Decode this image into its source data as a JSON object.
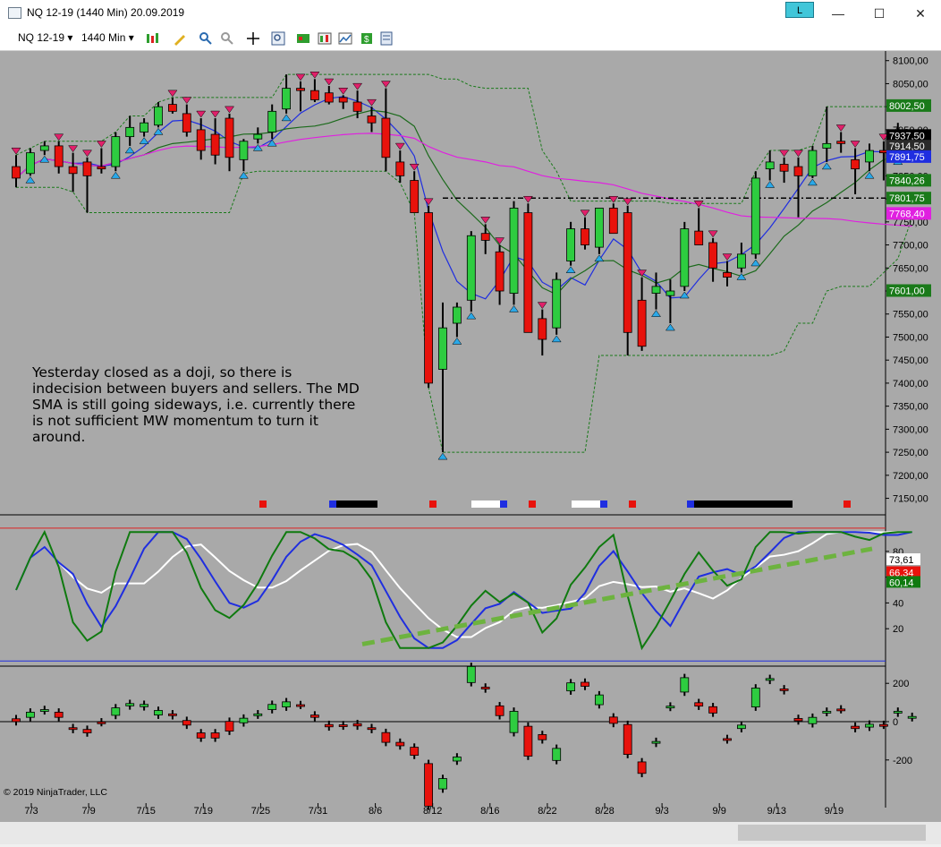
{
  "window": {
    "title": "NQ 12-19 (1440 Min)  20.09.2019",
    "badge": "L",
    "minimize": "—",
    "maximize": "☐",
    "close": "✕"
  },
  "toolbar": {
    "instrument": "NQ 12-19",
    "interval": "1440 Min"
  },
  "annotation": "Yesterday closed as a doji, so there is indecision between buyers and sellers. The MD SMA is still going sideways, i.e. currently there is not sufficient MW momentum to turn it around.",
  "copyright": "© 2019 NinjaTrader, LLC",
  "colors": {
    "background": "#a9a9a9",
    "bull": "#2ecc40",
    "bear": "#e8120c",
    "neutral_dark": "#8b1a1a",
    "upper_band": "#1a7a1a",
    "sma_blue": "#1f2ee0",
    "sma_magenta": "#e020e0",
    "rsi_green": "#0f7a0f",
    "rsi_white": "#ffffff"
  },
  "chart_data": [
    {
      "type": "candlestick",
      "panel": "price",
      "x_ticks": [
        "7/3",
        "7/9",
        "7/15",
        "7/19",
        "7/25",
        "7/31",
        "8/6",
        "8/12",
        "8/16",
        "8/22",
        "8/28",
        "9/3",
        "9/9",
        "9/13",
        "9/19"
      ],
      "y_ticks": [
        "8100,00",
        "8050,00",
        "8000,00",
        "7950,00",
        "7900,00",
        "7850,00",
        "7800,00",
        "7750,00",
        "7700,00",
        "7650,00",
        "7600,00",
        "7550,00",
        "7500,00",
        "7450,00",
        "7400,00",
        "7350,00",
        "7300,00",
        "7250,00",
        "7200,00",
        "7150,00"
      ],
      "ylim": [
        7120,
        8115
      ],
      "price_labels": [
        {
          "value": "8002,50",
          "color": "#1a7a1a"
        },
        {
          "value": "7937,50",
          "color": "#000000"
        },
        {
          "value": "7914,50",
          "color": "#2a2a2a"
        },
        {
          "value": "7891,75",
          "color": "#1f2ee0"
        },
        {
          "value": "7840,26",
          "color": "#1a7a1a"
        },
        {
          "value": "7801,75",
          "color": "#1a7a1a"
        },
        {
          "value": "7768,40",
          "color": "#e020e0"
        },
        {
          "value": "7601,00",
          "color": "#1a7a1a"
        }
      ],
      "candles": [
        {
          "o": 7870,
          "h": 7895,
          "l": 7825,
          "c": 7845
        },
        {
          "o": 7855,
          "h": 7910,
          "l": 7850,
          "c": 7900
        },
        {
          "o": 7905,
          "h": 7925,
          "l": 7895,
          "c": 7915
        },
        {
          "o": 7915,
          "h": 7925,
          "l": 7855,
          "c": 7870
        },
        {
          "o": 7870,
          "h": 7900,
          "l": 7815,
          "c": 7855
        },
        {
          "o": 7880,
          "h": 7890,
          "l": 7770,
          "c": 7850
        },
        {
          "o": 7870,
          "h": 7910,
          "l": 7855,
          "c": 7865
        },
        {
          "o": 7870,
          "h": 7945,
          "l": 7860,
          "c": 7935
        },
        {
          "o": 7935,
          "h": 7980,
          "l": 7915,
          "c": 7955
        },
        {
          "o": 7945,
          "h": 7975,
          "l": 7935,
          "c": 7965
        },
        {
          "o": 7960,
          "h": 8010,
          "l": 7955,
          "c": 8000
        },
        {
          "o": 8005,
          "h": 8020,
          "l": 7985,
          "c": 7990
        },
        {
          "o": 7985,
          "h": 8005,
          "l": 7935,
          "c": 7945
        },
        {
          "o": 7950,
          "h": 7975,
          "l": 7885,
          "c": 7905
        },
        {
          "o": 7940,
          "h": 7975,
          "l": 7875,
          "c": 7895
        },
        {
          "o": 7975,
          "h": 7985,
          "l": 7860,
          "c": 7890
        },
        {
          "o": 7885,
          "h": 7930,
          "l": 7860,
          "c": 7925
        },
        {
          "o": 7930,
          "h": 7955,
          "l": 7920,
          "c": 7940
        },
        {
          "o": 7945,
          "h": 8005,
          "l": 7930,
          "c": 7990
        },
        {
          "o": 7995,
          "h": 8070,
          "l": 7985,
          "c": 8040
        },
        {
          "o": 8040,
          "h": 8055,
          "l": 7990,
          "c": 8035
        },
        {
          "o": 8035,
          "h": 8060,
          "l": 8010,
          "c": 8015
        },
        {
          "o": 8030,
          "h": 8045,
          "l": 8005,
          "c": 8010
        },
        {
          "o": 8020,
          "h": 8025,
          "l": 7995,
          "c": 8010
        },
        {
          "o": 8010,
          "h": 8035,
          "l": 7975,
          "c": 7990
        },
        {
          "o": 7980,
          "h": 8000,
          "l": 7945,
          "c": 7965
        },
        {
          "o": 7975,
          "h": 8040,
          "l": 7860,
          "c": 7890
        },
        {
          "o": 7880,
          "h": 7905,
          "l": 7835,
          "c": 7850
        },
        {
          "o": 7840,
          "h": 7860,
          "l": 7770,
          "c": 7770
        },
        {
          "o": 7770,
          "h": 7785,
          "l": 7390,
          "c": 7400
        },
        {
          "o": 7430,
          "h": 7575,
          "l": 7250,
          "c": 7520
        },
        {
          "o": 7530,
          "h": 7575,
          "l": 7500,
          "c": 7565
        },
        {
          "o": 7580,
          "h": 7730,
          "l": 7555,
          "c": 7720
        },
        {
          "o": 7725,
          "h": 7745,
          "l": 7680,
          "c": 7710
        },
        {
          "o": 7685,
          "h": 7700,
          "l": 7570,
          "c": 7600
        },
        {
          "o": 7595,
          "h": 7795,
          "l": 7570,
          "c": 7780
        },
        {
          "o": 7770,
          "h": 7790,
          "l": 7550,
          "c": 7510
        },
        {
          "o": 7540,
          "h": 7560,
          "l": 7460,
          "c": 7495
        },
        {
          "o": 7520,
          "h": 7640,
          "l": 7505,
          "c": 7625
        },
        {
          "o": 7665,
          "h": 7750,
          "l": 7655,
          "c": 7735
        },
        {
          "o": 7735,
          "h": 7760,
          "l": 7690,
          "c": 7700
        },
        {
          "o": 7695,
          "h": 7760,
          "l": 7680,
          "c": 7780
        },
        {
          "o": 7780,
          "h": 7790,
          "l": 7725,
          "c": 7725
        },
        {
          "o": 7770,
          "h": 7785,
          "l": 7460,
          "c": 7510
        },
        {
          "o": 7580,
          "h": 7630,
          "l": 7470,
          "c": 7480
        },
        {
          "o": 7595,
          "h": 7640,
          "l": 7560,
          "c": 7610
        },
        {
          "o": 7590,
          "h": 7625,
          "l": 7530,
          "c": 7600
        },
        {
          "o": 7610,
          "h": 7750,
          "l": 7600,
          "c": 7735
        },
        {
          "o": 7730,
          "h": 7780,
          "l": 7700,
          "c": 7700
        },
        {
          "o": 7705,
          "h": 7715,
          "l": 7620,
          "c": 7650
        },
        {
          "o": 7640,
          "h": 7665,
          "l": 7610,
          "c": 7630
        },
        {
          "o": 7650,
          "h": 7705,
          "l": 7640,
          "c": 7680
        },
        {
          "o": 7680,
          "h": 7860,
          "l": 7670,
          "c": 7845
        },
        {
          "o": 7865,
          "h": 7905,
          "l": 7840,
          "c": 7880
        },
        {
          "o": 7875,
          "h": 7890,
          "l": 7835,
          "c": 7860
        },
        {
          "o": 7870,
          "h": 7890,
          "l": 7760,
          "c": 7850
        },
        {
          "o": 7850,
          "h": 7915,
          "l": 7845,
          "c": 7905
        },
        {
          "o": 7910,
          "h": 8000,
          "l": 7880,
          "c": 7920
        },
        {
          "o": 7925,
          "h": 7945,
          "l": 7900,
          "c": 7920
        },
        {
          "o": 7885,
          "h": 7910,
          "l": 7810,
          "c": 7865
        },
        {
          "o": 7880,
          "h": 7920,
          "l": 7860,
          "c": 7905
        },
        {
          "o": 7905,
          "h": 7925,
          "l": 7840,
          "c": 7900
        },
        {
          "o": 7910,
          "h": 7965,
          "l": 7890,
          "c": 7925
        },
        {
          "o": 7925,
          "h": 7945,
          "l": 7910,
          "c": 7935
        }
      ],
      "signal_blocks": [
        {
          "x": 290,
          "w": 8,
          "color": "#e8120c"
        },
        {
          "x": 368,
          "w": 8,
          "color": "#1f2ee0"
        },
        {
          "x": 376,
          "w": 46,
          "color": "#000000"
        },
        {
          "x": 480,
          "w": 8,
          "color": "#e8120c"
        },
        {
          "x": 527,
          "w": 32,
          "color": "#ffffff"
        },
        {
          "x": 559,
          "w": 8,
          "color": "#1f2ee0"
        },
        {
          "x": 591,
          "w": 8,
          "color": "#e8120c"
        },
        {
          "x": 639,
          "w": 32,
          "color": "#ffffff"
        },
        {
          "x": 671,
          "w": 8,
          "color": "#1f2ee0"
        },
        {
          "x": 703,
          "w": 8,
          "color": "#e8120c"
        },
        {
          "x": 768,
          "w": 8,
          "color": "#1f2ee0"
        },
        {
          "x": 776,
          "w": 110,
          "color": "#000000"
        },
        {
          "x": 943,
          "w": 8,
          "color": "#e8120c"
        }
      ]
    },
    {
      "type": "line",
      "panel": "oscillator",
      "y_ticks": [
        "80",
        "60",
        "40",
        "20"
      ],
      "ylim": [
        0,
        100
      ],
      "value_labels": [
        {
          "value": "73,61",
          "color": "#ffffff"
        },
        {
          "value": "66,34",
          "color": "#e8120c"
        },
        {
          "value": "60,14",
          "color": "#0f7a0f"
        }
      ]
    },
    {
      "type": "candlestick",
      "panel": "momentum",
      "y_ticks": [
        "200",
        "0",
        "-200"
      ],
      "ylim": [
        -300,
        260
      ]
    }
  ]
}
